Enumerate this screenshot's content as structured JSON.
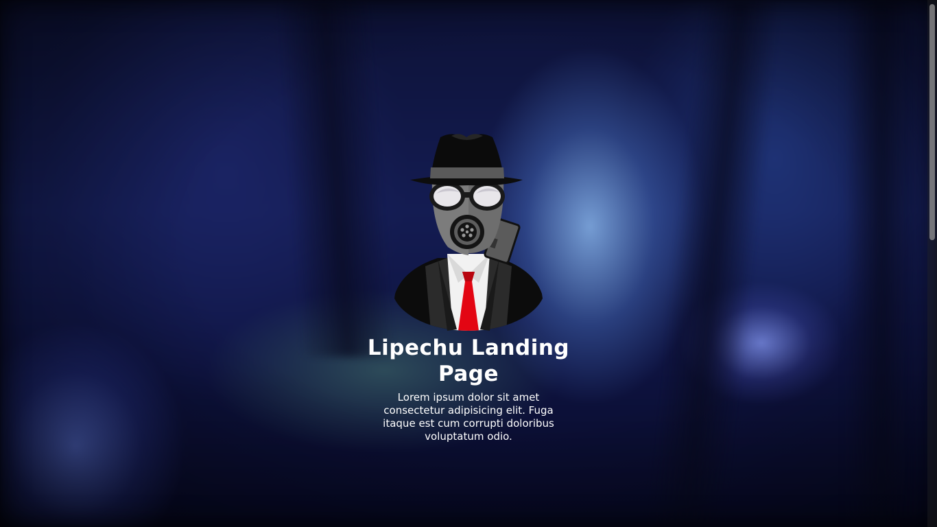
{
  "hero": {
    "title": "Lipechu Landing Page",
    "description": "Lorem ipsum dolor sit amet consectetur adipisicing elit. Fuga itaque est cum corrupti doloribus voluptatum odio.",
    "avatar_icon": "gas-mask-spy-icon"
  },
  "colors": {
    "text": "#ffffff",
    "tie": "#e30613",
    "background": "#141c52"
  }
}
